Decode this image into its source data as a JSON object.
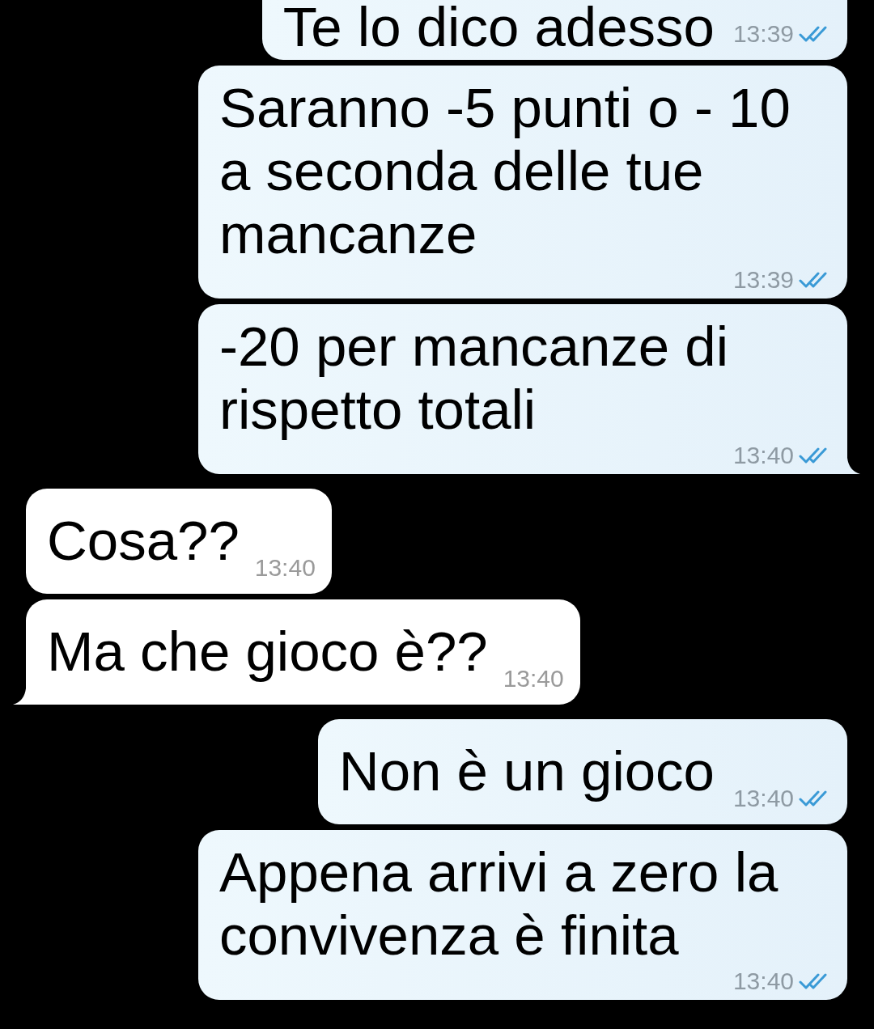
{
  "messages": [
    {
      "kind": "outgoing",
      "text": "Te lo dico adesso",
      "time": "13:39",
      "read": true,
      "tail": false
    },
    {
      "kind": "outgoing",
      "text": "Saranno -5 punti o - 10 a seconda delle tue mancanze",
      "time": "13:39",
      "read": true,
      "tail": false
    },
    {
      "kind": "outgoing",
      "text": "-20 per mancanze di rispetto totali",
      "time": "13:40",
      "read": true,
      "tail": true
    },
    {
      "kind": "incoming",
      "text": "Cosa??",
      "time": "13:40",
      "tail": false
    },
    {
      "kind": "incoming",
      "text": "Ma che gioco è??",
      "time": "13:40",
      "tail": true
    },
    {
      "kind": "outgoing",
      "text": "Non è un gioco",
      "time": "13:40",
      "read": true,
      "tail": false
    },
    {
      "kind": "outgoing",
      "text": "Appena arrivi a zero la convivenza è finita",
      "time": "13:40",
      "read": true,
      "tail": false
    }
  ]
}
